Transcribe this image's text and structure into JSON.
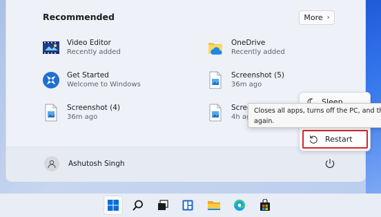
{
  "recommended": {
    "title": "Recommended",
    "more_label": "More",
    "items": [
      {
        "name": "Video Editor",
        "sub": "Recently added",
        "icon": "video-editor-icon"
      },
      {
        "name": "OneDrive",
        "sub": "Recently added",
        "icon": "onedrive-icon"
      },
      {
        "name": "Get Started",
        "sub": "Welcome to Windows",
        "icon": "get-started-icon"
      },
      {
        "name": "Screenshot (5)",
        "sub": "36m ago",
        "icon": "image-file-icon"
      },
      {
        "name": "Screenshot (4)",
        "sub": "36m ago",
        "icon": "image-file-icon"
      },
      {
        "name": "Scree",
        "sub": "4h ag",
        "icon": "image-file-icon"
      }
    ]
  },
  "power_menu": {
    "sleep_label": "Sleep",
    "restart_label": "Restart"
  },
  "tooltip": {
    "line1": "Closes all apps, turns off the PC, and then",
    "line2": "again."
  },
  "user": {
    "name": "Ashutosh Singh"
  },
  "colors": {
    "highlight": "#d7242a",
    "accent": "#0067c0"
  },
  "taskbar": {
    "icons": [
      "start-icon",
      "search-icon",
      "task-view-icon",
      "widgets-icon",
      "file-explorer-icon",
      "edge-icon",
      "store-icon"
    ]
  }
}
